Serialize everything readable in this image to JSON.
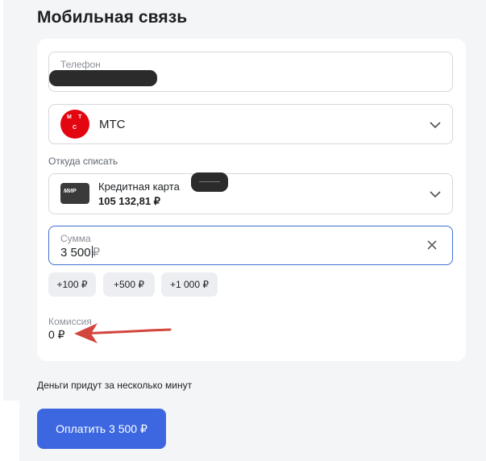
{
  "page": {
    "title": "Мобильная связь"
  },
  "phone": {
    "label": "Телефон"
  },
  "operator": {
    "name": "МТС",
    "logo_letters": [
      "М",
      "Т",
      "С"
    ],
    "logo_color": "#e30611"
  },
  "source": {
    "label": "Откуда списать",
    "card_logo": "МИР",
    "card_name": "Кредитная карта",
    "balance": "105 132,81 ₽"
  },
  "amount": {
    "label": "Сумма",
    "value": "3 500",
    "currency": "₽"
  },
  "quick_amounts": [
    "+100 ₽",
    "+500 ₽",
    "+1 000 ₽"
  ],
  "commission": {
    "label": "Комиссия",
    "value": "0 ₽"
  },
  "note": "Деньги придут за несколько минут",
  "pay_button": {
    "label": "Оплатить 3 500 ₽"
  },
  "colors": {
    "accent": "#3c67e0",
    "focus_border": "#3d6fd0",
    "annotation_arrow": "#d2463e"
  }
}
